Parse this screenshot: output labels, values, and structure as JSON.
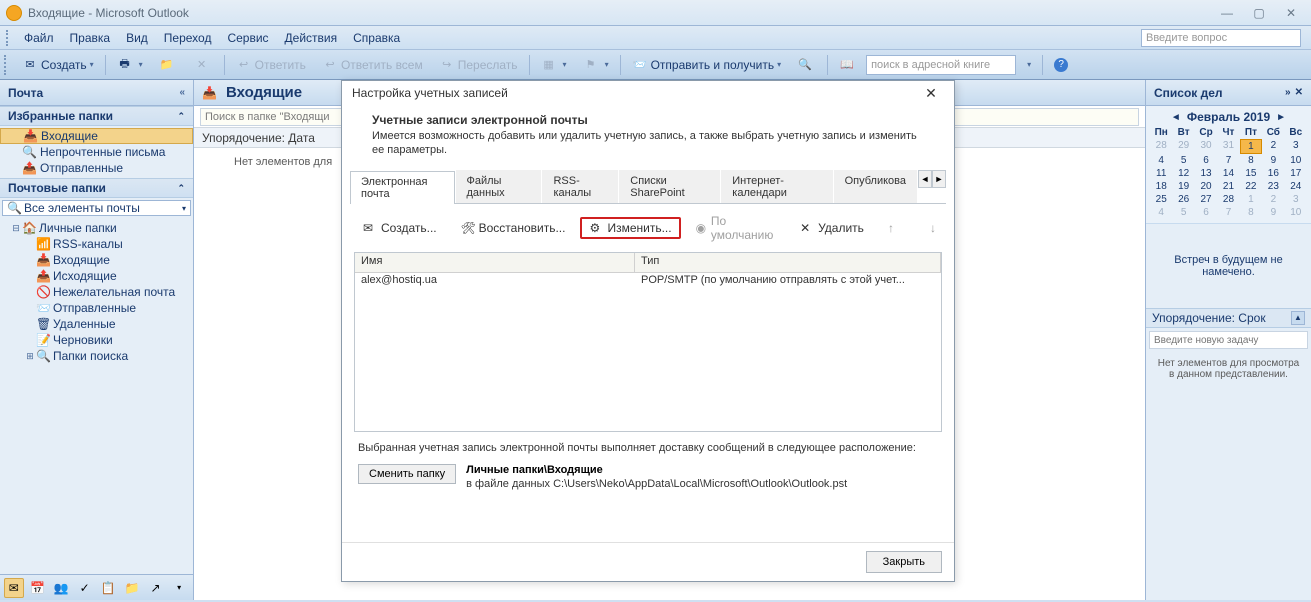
{
  "window_title": "Входящие - Microsoft Outlook",
  "menubar": [
    "Файл",
    "Правка",
    "Вид",
    "Переход",
    "Сервис",
    "Действия",
    "Справка"
  ],
  "question_placeholder": "Введите вопрос",
  "toolbar": {
    "create": "Создать",
    "reply": "Ответить",
    "reply_all": "Ответить всем",
    "forward": "Переслать",
    "send_receive": "Отправить и получить",
    "search_placeholder": "поиск в адресной книге"
  },
  "leftnav": {
    "header": "Почта",
    "fav_header": "Избранные папки",
    "fav_items": [
      "Входящие",
      "Непрочтенные письма",
      "Отправленные"
    ],
    "mail_header": "Почтовые папки",
    "all_items": "Все элементы почты",
    "tree": {
      "root": "Личные папки",
      "children": [
        "RSS-каналы",
        "Входящие",
        "Исходящие",
        "Нежелательная почта",
        "Отправленные",
        "Удаленные",
        "Черновики",
        "Папки поиска"
      ]
    }
  },
  "content": {
    "title": "Входящие",
    "search_placeholder": "Поиск в папке \"Входящи",
    "sort_label": "Упорядочение: Дата",
    "empty": "Нет элементов для"
  },
  "rightpane": {
    "header": "Список дел",
    "cal_title": "Февраль 2019",
    "dow": [
      "Пн",
      "Вт",
      "Ср",
      "Чт",
      "Пт",
      "Сб",
      "Вс"
    ],
    "cal_prev": [
      28,
      29,
      30,
      31
    ],
    "cal_days_count": 28,
    "cal_today": 1,
    "cal_next": [
      1,
      2,
      3,
      4,
      5,
      6,
      7,
      8,
      9,
      10
    ],
    "appt_msg": "Встреч в будущем не намечено.",
    "task_sort": "Упорядочение: Срок",
    "task_placeholder": "Введите новую задачу",
    "task_empty": "Нет элементов для просмотра в данном представлении."
  },
  "dialog": {
    "title": "Настройка учетных записей",
    "heading": "Учетные записи электронной почты",
    "subheading": "Имеется возможность добавить или удалить учетную запись, а также выбрать учетную запись и изменить ее параметры.",
    "tabs": [
      "Электронная почта",
      "Файлы данных",
      "RSS-каналы",
      "Списки SharePoint",
      "Интернет-календари",
      "Опубликова"
    ],
    "toolbar": {
      "create": "Создать...",
      "repair": "Восстановить...",
      "change": "Изменить...",
      "default": "По умолчанию",
      "delete": "Удалить"
    },
    "columns": [
      "Имя",
      "Тип"
    ],
    "account": {
      "name": "alex@hostiq.ua",
      "type": "POP/SMTP (по умолчанию отправлять с этой учет..."
    },
    "delivery_text": "Выбранная учетная запись электронной почты выполняет доставку сообщений в следующее расположение:",
    "change_folder_btn": "Сменить папку",
    "delivery_location": "Личные папки\\Входящие",
    "delivery_file": "в файле данных C:\\Users\\Neko\\AppData\\Local\\Microsoft\\Outlook\\Outlook.pst",
    "close_btn": "Закрыть"
  }
}
